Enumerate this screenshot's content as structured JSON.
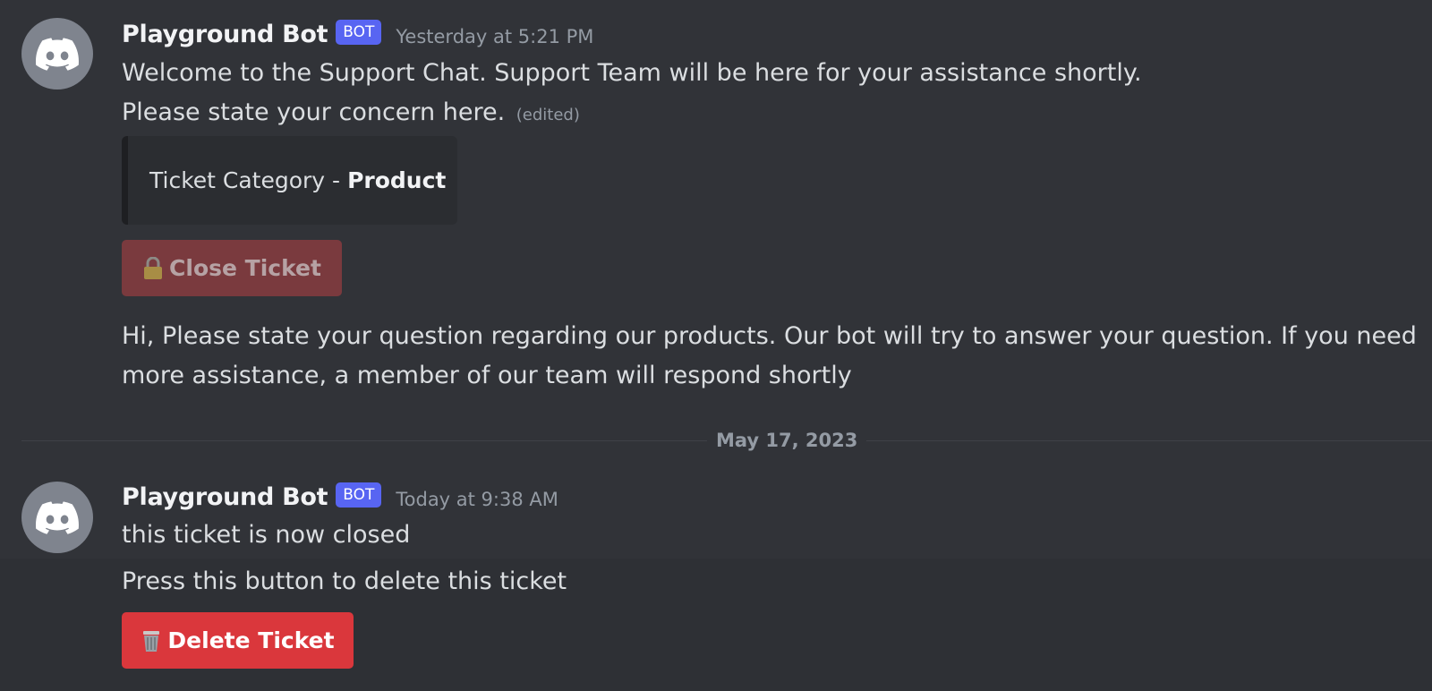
{
  "messages": [
    {
      "author": "Playground Bot",
      "tag": "BOT",
      "timestamp": "Yesterday at 5:21 PM",
      "lines": [
        "Welcome to the Support Chat. Support Team will be here for your assistance shortly.",
        "Please state your concern here."
      ],
      "edited": "(edited)",
      "embed": {
        "prefix": "Ticket Category -",
        "bold": "Product"
      },
      "button": {
        "label": "Close Ticket",
        "icon": "lock-icon",
        "color": "#7a3a3e"
      },
      "followup": [
        "Hi, Please state your question regarding our products. Our bot will try to answer your question. If you need",
        "more assistance, a member of our team will respond shortly"
      ]
    },
    {
      "author": "Playground Bot",
      "tag": "BOT",
      "timestamp": "Today at 9:38 AM",
      "lines": [
        "this ticket is now closed"
      ],
      "followup": [
        "Press this button to delete this ticket"
      ],
      "button": {
        "label": "Delete Ticket",
        "icon": "wastebasket-icon",
        "color": "#da373c"
      }
    }
  ],
  "date_divider": "May 17, 2023",
  "colors": {
    "background": "#313338",
    "bot_tag": "#5865f2",
    "avatar": "#7f848e"
  }
}
